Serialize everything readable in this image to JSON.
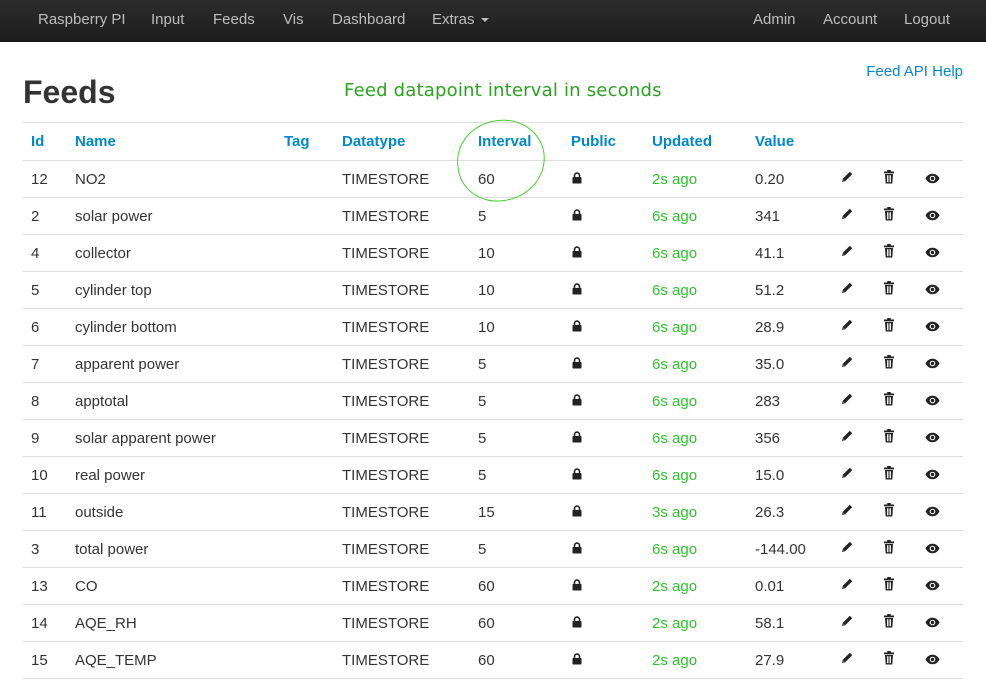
{
  "nav": {
    "brand": "Raspberry PI",
    "items": [
      "Input",
      "Feeds",
      "Vis",
      "Dashboard",
      "Extras"
    ],
    "right_items": [
      "Admin",
      "Account",
      "Logout"
    ]
  },
  "page": {
    "title": "Feeds",
    "annotation": "Feed datapoint interval in seconds",
    "api_help": "Feed API Help"
  },
  "table": {
    "headers": [
      "Id",
      "Name",
      "Tag",
      "Datatype",
      "Interval",
      "Public",
      "Updated",
      "Value"
    ],
    "rows": [
      {
        "id": "12",
        "name": "NO2",
        "tag": "",
        "datatype": "TIMESTORE",
        "interval": "60",
        "updated": "2s ago",
        "value": "0.20"
      },
      {
        "id": "2",
        "name": "solar power",
        "tag": "",
        "datatype": "TIMESTORE",
        "interval": "5",
        "updated": "6s ago",
        "value": "341"
      },
      {
        "id": "4",
        "name": "collector",
        "tag": "",
        "datatype": "TIMESTORE",
        "interval": "10",
        "updated": "6s ago",
        "value": "41.1"
      },
      {
        "id": "5",
        "name": "cylinder top",
        "tag": "",
        "datatype": "TIMESTORE",
        "interval": "10",
        "updated": "6s ago",
        "value": "51.2"
      },
      {
        "id": "6",
        "name": "cylinder bottom",
        "tag": "",
        "datatype": "TIMESTORE",
        "interval": "10",
        "updated": "6s ago",
        "value": "28.9"
      },
      {
        "id": "7",
        "name": "apparent power",
        "tag": "",
        "datatype": "TIMESTORE",
        "interval": "5",
        "updated": "6s ago",
        "value": "35.0"
      },
      {
        "id": "8",
        "name": "apptotal",
        "tag": "",
        "datatype": "TIMESTORE",
        "interval": "5",
        "updated": "6s ago",
        "value": "283"
      },
      {
        "id": "9",
        "name": "solar apparent power",
        "tag": "",
        "datatype": "TIMESTORE",
        "interval": "5",
        "updated": "6s ago",
        "value": "356"
      },
      {
        "id": "10",
        "name": "real power",
        "tag": "",
        "datatype": "TIMESTORE",
        "interval": "5",
        "updated": "6s ago",
        "value": "15.0"
      },
      {
        "id": "11",
        "name": "outside",
        "tag": "",
        "datatype": "TIMESTORE",
        "interval": "15",
        "updated": "3s ago",
        "value": "26.3"
      },
      {
        "id": "3",
        "name": "total power",
        "tag": "",
        "datatype": "TIMESTORE",
        "interval": "5",
        "updated": "6s ago",
        "value": "-144.00"
      },
      {
        "id": "13",
        "name": "CO",
        "tag": "",
        "datatype": "TIMESTORE",
        "interval": "60",
        "updated": "2s ago",
        "value": "0.01"
      },
      {
        "id": "14",
        "name": "AQE_RH",
        "tag": "",
        "datatype": "TIMESTORE",
        "interval": "60",
        "updated": "2s ago",
        "value": "58.1"
      },
      {
        "id": "15",
        "name": "AQE_TEMP",
        "tag": "",
        "datatype": "TIMESTORE",
        "interval": "60",
        "updated": "2s ago",
        "value": "27.9"
      }
    ]
  },
  "icons": {
    "public": "lock-icon",
    "edit": "pencil-icon",
    "delete": "trash-icon",
    "view": "eye-icon"
  },
  "colors": {
    "navbar": "#222222",
    "link": "#0088cc",
    "updated": "#2ec32e",
    "annotation": "#2aa31e"
  }
}
